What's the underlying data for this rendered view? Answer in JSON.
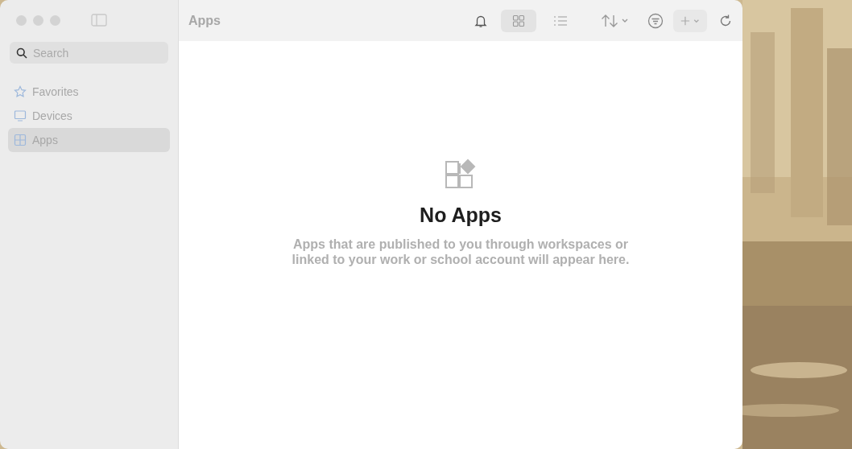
{
  "sidebar": {
    "search": {
      "placeholder": "Search"
    },
    "items": [
      {
        "label": "Favorites",
        "kind": "star",
        "selected": false
      },
      {
        "label": "Devices",
        "kind": "monitor",
        "selected": false
      },
      {
        "label": "Apps",
        "kind": "apps",
        "selected": true
      }
    ]
  },
  "toolbar": {
    "title": "Apps",
    "views": [
      {
        "kind": "grid",
        "selected": true
      },
      {
        "kind": "list",
        "selected": false
      }
    ]
  },
  "empty_state": {
    "title": "No Apps",
    "message": "Apps that are published to you through workspaces or linked to your work or school account will appear here."
  }
}
